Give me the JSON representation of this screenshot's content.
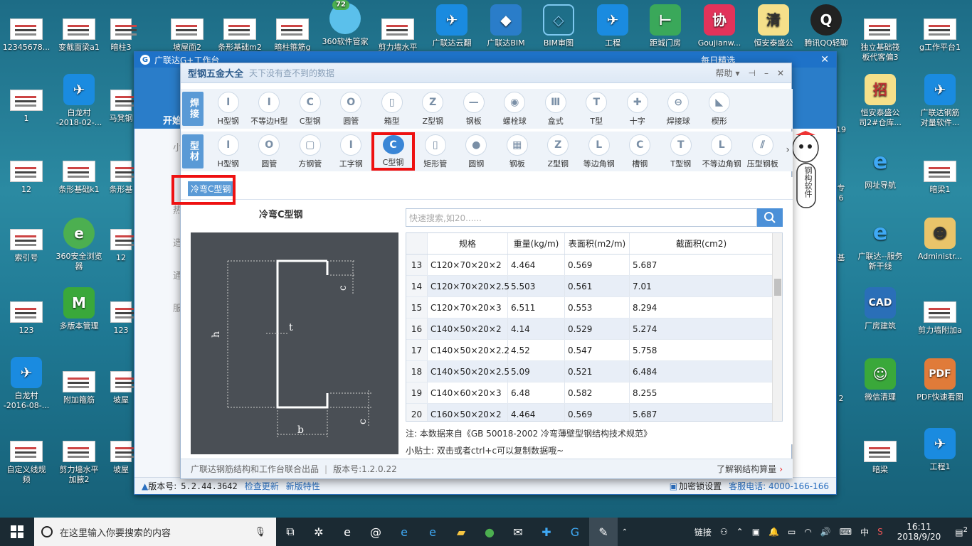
{
  "desktop_left": [
    {
      "label": "12345678...",
      "type": "thumb"
    },
    {
      "label": "1",
      "type": "thumb"
    },
    {
      "label": "12",
      "type": "thumb"
    },
    {
      "label": "索引号",
      "type": "thumb"
    },
    {
      "label": "123",
      "type": "thumb"
    },
    {
      "label": "白龙村\n-2016-08-...",
      "type": "app"
    },
    {
      "label": "自定义线规\n频",
      "type": "thumb"
    }
  ],
  "desktop_col2": [
    {
      "label": "变截面梁a1"
    },
    {
      "label": "白龙村\n-2018-02-..."
    },
    {
      "label": "条形基础k1"
    },
    {
      "label": "360安全浏览\n器"
    },
    {
      "label": "多版本管理"
    },
    {
      "label": "附加箍筋"
    },
    {
      "label": "剪力墙水平\n加腋2"
    }
  ],
  "desktop_col3": [
    {
      "label": "暗柱3"
    },
    {
      "label": "马凳钢"
    },
    {
      "label": "条形基"
    },
    {
      "label": "12"
    },
    {
      "label": "123"
    },
    {
      "label": "坡屋"
    },
    {
      "label": "坡屋"
    }
  ],
  "top_row": [
    {
      "label": "坡屋面2"
    },
    {
      "label": "条形基础m2"
    },
    {
      "label": "暗柱箍筋g"
    },
    {
      "label": "360软件管家"
    },
    {
      "label": "剪力墙水平"
    },
    {
      "label": "广联达云翻"
    },
    {
      "label": "广联达BIM"
    },
    {
      "label": "BIM审图"
    },
    {
      "label": "工程"
    },
    {
      "label": "距城门房"
    },
    {
      "label": "Goujianw..."
    },
    {
      "label": "恒安泰盛公"
    },
    {
      "label": "腾讯QQ轻聊"
    },
    {
      "label": "独立基础筏\n板代客偏3"
    },
    {
      "label": "g工作平台1"
    }
  ],
  "badge_72": "72",
  "desktop_right_col1": [
    {
      "label": "恒安泰盛公\n司2#仓库..."
    },
    {
      "label": "网址导航"
    },
    {
      "label": "广联达--服务\n新干线"
    },
    {
      "label": "厂房建筑"
    },
    {
      "label": "微信清理"
    },
    {
      "label": "暗梁"
    }
  ],
  "desktop_right_col2": [
    {
      "label": "广联达钢筋\n对量软件..."
    },
    {
      "label": "暗梁1"
    },
    {
      "label": "Administr..."
    },
    {
      "label": "剪力墙附加a"
    },
    {
      "label": "PDF快速看图"
    },
    {
      "label": "工程1"
    }
  ],
  "right_partial": [
    {
      "label": "19"
    },
    {
      "label": "专\n6"
    },
    {
      "label": "基"
    },
    {
      "label": "2"
    }
  ],
  "bg_window": {
    "title": "广联达G+工作台",
    "top_right": "每日精选",
    "left_items": [
      "小",
      "热",
      "造",
      "通",
      "服"
    ],
    "nav_item": "开始",
    "footer_version_label": "版本号:",
    "footer_version": "5.2.44.3642",
    "footer_check": "检查更新",
    "footer_new": "新版特性",
    "footer_lock": "加密锁设置",
    "footer_service": "客服电话: 4000-166-166"
  },
  "main": {
    "title": "型钢五金大全",
    "subtitle": "天下没有查不到的数据",
    "help": "帮助",
    "row1_label": "焊接",
    "row1": [
      {
        "label": "H型钢",
        "glyph": "I"
      },
      {
        "label": "不等边H型",
        "glyph": "I"
      },
      {
        "label": "C型钢",
        "glyph": "C"
      },
      {
        "label": "圆管",
        "glyph": "O"
      },
      {
        "label": "箱型",
        "glyph": "▯"
      },
      {
        "label": "Z型钢",
        "glyph": "Z"
      },
      {
        "label": "钢板",
        "glyph": "—"
      },
      {
        "label": "螺栓球",
        "glyph": "◉"
      },
      {
        "label": "盒式",
        "glyph": "Ⅲ"
      },
      {
        "label": "T型",
        "glyph": "T"
      },
      {
        "label": "十字",
        "glyph": "✚"
      },
      {
        "label": "焊接球",
        "glyph": "⊖"
      },
      {
        "label": "楔形",
        "glyph": "◣"
      }
    ],
    "row2_label": "型材",
    "row2": [
      {
        "label": "H型钢",
        "glyph": "I"
      },
      {
        "label": "圆管",
        "glyph": "O"
      },
      {
        "label": "方钢管",
        "glyph": "▢"
      },
      {
        "label": "工字钢",
        "glyph": "I"
      },
      {
        "label": "C型钢",
        "glyph": "C",
        "selected": true
      },
      {
        "label": "矩形管",
        "glyph": "▯"
      },
      {
        "label": "圆钢",
        "glyph": "●"
      },
      {
        "label": "钢板",
        "glyph": "▦"
      },
      {
        "label": "Z型钢",
        "glyph": "Z"
      },
      {
        "label": "等边角钢",
        "glyph": "L"
      },
      {
        "label": "槽钢",
        "glyph": "C"
      },
      {
        "label": "T型钢",
        "glyph": "T"
      },
      {
        "label": "不等边角钢",
        "glyph": "L"
      },
      {
        "label": "压型钢板",
        "glyph": "⫽"
      }
    ],
    "crumb": "冷弯C型钢",
    "figure_title": "冷弯C型钢",
    "figure_labels": {
      "h": "h",
      "t": "t",
      "b": "b",
      "c": "c"
    },
    "search_placeholder": "快速搜索,如20......",
    "table_headers": [
      "规格",
      "重量(kg/m)",
      "表面积(m2/m)",
      "截面积(cm2)"
    ],
    "rows": [
      {
        "n": "13",
        "spec": "C120×70×20×2",
        "w": "4.464",
        "s": "0.569",
        "a": "5.687"
      },
      {
        "n": "14",
        "spec": "C120×70×20×2.5",
        "w": "5.503",
        "s": "0.561",
        "a": "7.01"
      },
      {
        "n": "15",
        "spec": "C120×70×20×3",
        "w": "6.511",
        "s": "0.553",
        "a": "8.294"
      },
      {
        "n": "16",
        "spec": "C140×50×20×2",
        "w": "4.14",
        "s": "0.529",
        "a": "5.274"
      },
      {
        "n": "17",
        "spec": "C140×50×20×2.2",
        "w": "4.52",
        "s": "0.547",
        "a": "5.758"
      },
      {
        "n": "18",
        "spec": "C140×50×20×2.5",
        "w": "5.09",
        "s": "0.521",
        "a": "6.484"
      },
      {
        "n": "19",
        "spec": "C140×60×20×3",
        "w": "6.48",
        "s": "0.582",
        "a": "8.255"
      },
      {
        "n": "20",
        "spec": "C160×50×20×2",
        "w": "4.464",
        "s": "0.569",
        "a": "5.687"
      }
    ],
    "note": "注: 本数据来自《GB  50018-2002  冷弯薄壁型钢结构技术规范》",
    "tip": "小贴士: 双击或者ctrl+c可以复制数据哦~",
    "footer_left": "广联达钢筋结构和工作台联合出品",
    "footer_version": "版本号:1.2.0.22",
    "footer_link": "了解钢结构算量"
  },
  "mascot_text": "钢构软件",
  "taskbar": {
    "search_placeholder": "在这里输入你要搜索的内容",
    "tray_link": "链接",
    "ime": "中",
    "time": "16:11",
    "date": "2018/9/20",
    "notif": "2"
  },
  "colors": {
    "accent": "#3a86d6",
    "highlight": "#e11111",
    "title_blue": "#1e72c8"
  }
}
